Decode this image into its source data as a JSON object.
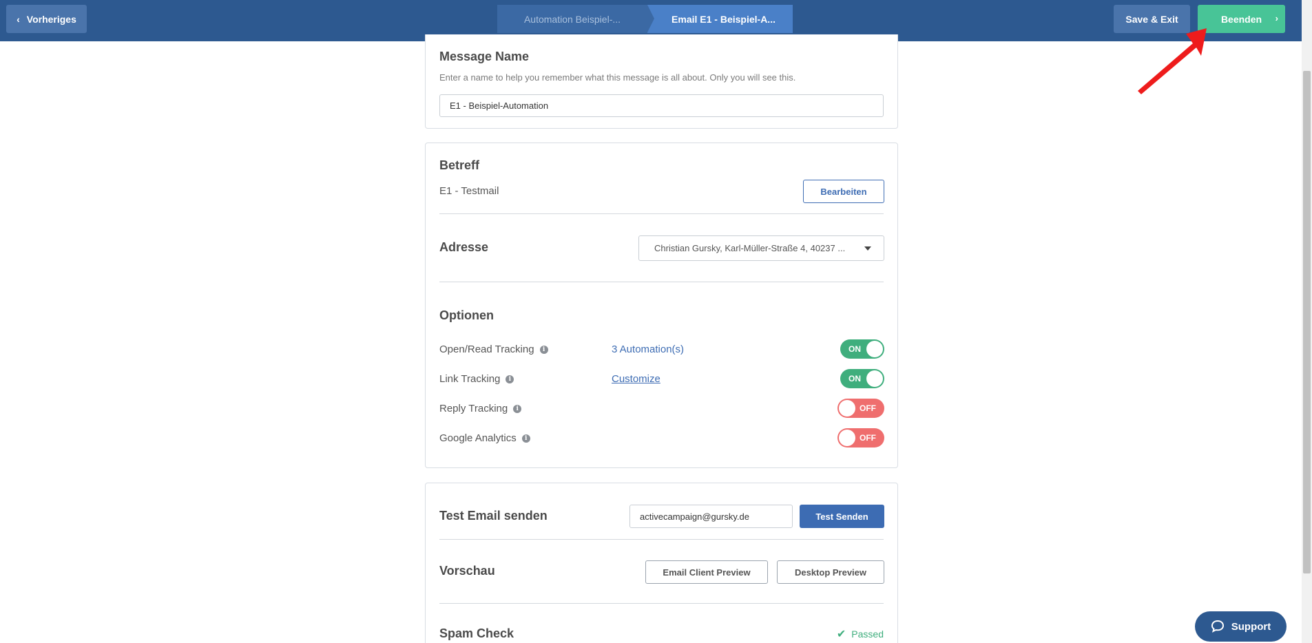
{
  "topbar": {
    "prev_label": "Vorheriges",
    "breadcrumbs": [
      "Automation Beispiel-...",
      "Email E1 - Beispiel-A..."
    ],
    "save_exit_label": "Save & Exit",
    "finish_label": "Beenden"
  },
  "message_name": {
    "title": "Message Name",
    "help": "Enter a name to help you remember what this message is all about. Only you will see this.",
    "value": "E1 - Beispiel-Automation"
  },
  "subject": {
    "title": "Betreff",
    "value": "E1 - Testmail",
    "edit_label": "Bearbeiten"
  },
  "address": {
    "title": "Adresse",
    "selected": "Christian Gursky, Karl-Müller-Straße 4, 40237 ..."
  },
  "options": {
    "title": "Optionen",
    "rows": [
      {
        "label": "Open/Read Tracking",
        "link": "3 Automation(s)",
        "state": "ON"
      },
      {
        "label": "Link Tracking",
        "link": "Customize",
        "state": "ON"
      },
      {
        "label": "Reply Tracking",
        "link": "",
        "state": "OFF"
      },
      {
        "label": "Google Analytics",
        "link": "",
        "state": "OFF"
      }
    ]
  },
  "test_email": {
    "title": "Test Email senden",
    "email_value": "activecampaign@gursky.de",
    "send_label": "Test Senden"
  },
  "preview": {
    "title": "Vorschau",
    "client_label": "Email Client Preview",
    "desktop_label": "Desktop Preview"
  },
  "spam_check": {
    "title": "Spam Check",
    "status": "Passed"
  },
  "support_label": "Support",
  "colors": {
    "header": "#2d5990",
    "accent_blue": "#3d6cb3",
    "success": "#3fae7d",
    "danger": "#ef6e6e",
    "finish": "#48c497"
  }
}
